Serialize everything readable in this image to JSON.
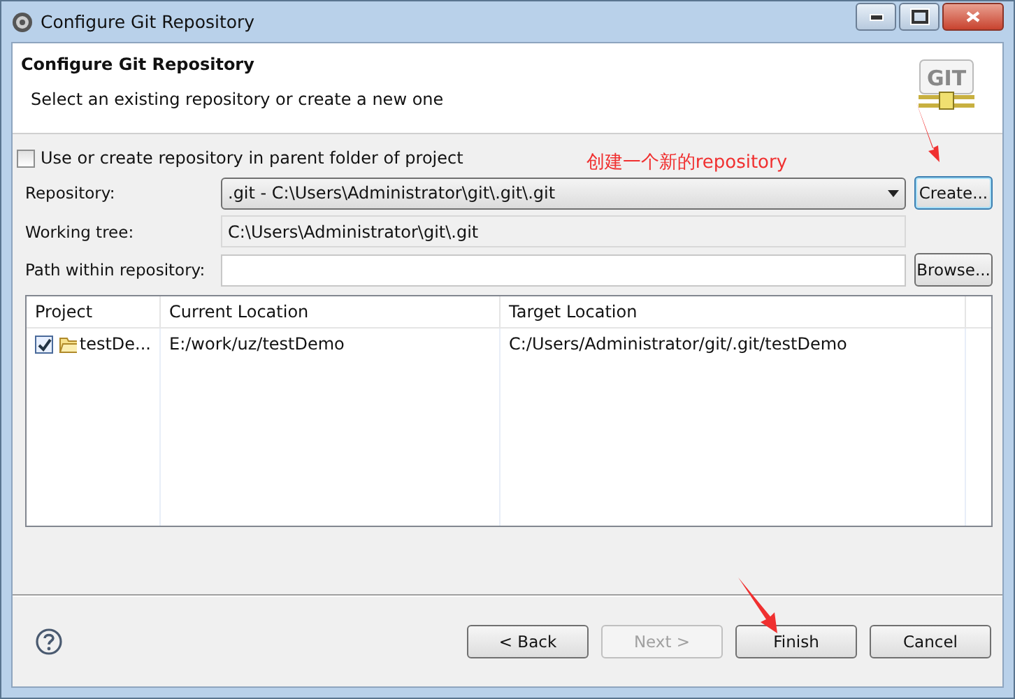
{
  "window": {
    "title": "Configure Git Repository"
  },
  "header": {
    "logo_text": "GIT",
    "title": "Configure Git Repository",
    "description": "Select an existing repository or create a new one"
  },
  "parent_folder_option": {
    "label": "Use or create repository in parent folder of project",
    "checked": false
  },
  "annotation": {
    "text": "创建一个新的repository"
  },
  "fields": [
    {
      "kind": "combo",
      "label": "Repository:",
      "value": ".git - C:\\Users\\Administrator\\git\\.git\\.git",
      "button": "Create..."
    },
    {
      "kind": "readonly",
      "label": "Working tree:",
      "value": "C:\\Users\\Administrator\\git\\.git"
    },
    {
      "kind": "text",
      "label": "Path within repository:",
      "button": "Browse..."
    }
  ],
  "table": {
    "columns": [
      "Project",
      "Current Location",
      "Target Location"
    ],
    "rows": [
      {
        "checked": true,
        "cells": [
          "testDe...",
          "E:/work/uz/testDemo",
          "C:/Users/Administrator/git/.git/testDemo"
        ]
      }
    ]
  },
  "buttons": [
    {
      "label": "< Back",
      "disabled": false
    },
    {
      "label": "Next >",
      "disabled": true
    },
    {
      "label": "Finish",
      "disabled": false
    },
    {
      "label": "Cancel",
      "disabled": false
    }
  ]
}
